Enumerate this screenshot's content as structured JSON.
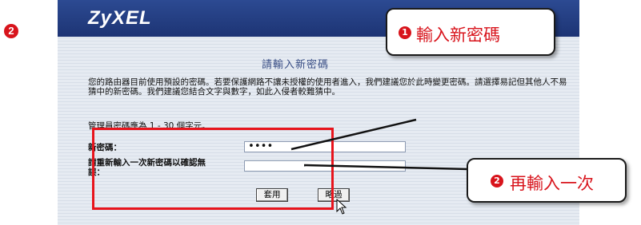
{
  "step_badge": "❷",
  "router": {
    "logo": "ZyXEL",
    "title": "請輸入新密碼",
    "description": "您的路由器目前使用預設的密碼。若要保護網路不讓未授權的使用者進入，我們建議您於此時變更密碼。請選擇易記但其他人不易猜中的新密碼。我們建議您結合文字與數字，如此入侵者較難猜中。",
    "range_note": "管理員密碼應為 1 - 30 個字元。",
    "new_password_label": "新密碼：",
    "new_password_value": "••••",
    "confirm_label": "請重新輸入一次新密碼以確認無誤：",
    "confirm_value": "",
    "apply_button": "套用",
    "skip_button": "略過"
  },
  "callouts": [
    {
      "number": "❶",
      "text": "輸入新密碼"
    },
    {
      "number": "❷",
      "text": "再輸入一次"
    }
  ],
  "colors": {
    "accent_red": "#d8141c",
    "header_blue": "#2c4a92"
  }
}
